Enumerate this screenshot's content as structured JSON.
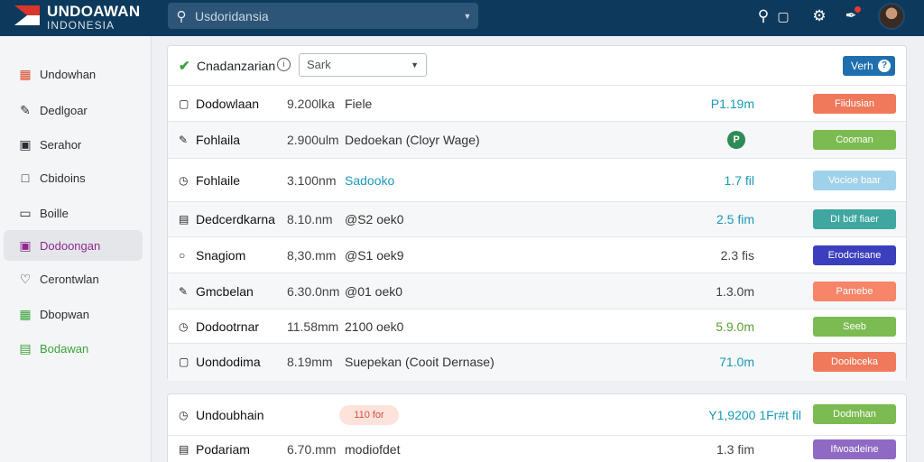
{
  "header": {
    "brand_title": "UNDOAWAN",
    "brand_subtitle": "INDONESIA",
    "search_value": "Usdoridansia"
  },
  "sidebar": {
    "items": [
      {
        "label": "Undowhan",
        "icon": "building-icon"
      },
      {
        "label": "Dedlgoar",
        "icon": "pencil-icon"
      },
      {
        "label": "Serahor",
        "icon": "monitor-icon"
      },
      {
        "label": "Cbidoins",
        "icon": "square-icon"
      },
      {
        "label": "Boille",
        "icon": "clipboard-icon"
      },
      {
        "label": "Dodoongan",
        "icon": "folder-icon"
      },
      {
        "label": "Cerontwlan",
        "icon": "heart-icon"
      },
      {
        "label": "Dbopwan",
        "icon": "calendar-icon"
      },
      {
        "label": "Bodawan",
        "icon": "document-icon"
      }
    ]
  },
  "panel": {
    "title": "Cnadanzarian",
    "select_value": "Sark",
    "header_button": "Verh"
  },
  "rows": [
    {
      "name": "Dodowlaan",
      "size": "9.200lka",
      "desc": "Fiele",
      "value": "P1.19m",
      "action": "Fiidusian"
    },
    {
      "name": "Fohlaila",
      "size": "2.900ulm",
      "desc": "Dedoekan (Cloyr Wage)",
      "value": "",
      "action": "Cooman"
    },
    {
      "name": "Fohlaile",
      "size": "3.100nm",
      "desc": "Sadooko",
      "value": "1.7 fil",
      "action": "Vocioe baar"
    },
    {
      "name": "Dedcerdkarna",
      "size": "8.10.nm",
      "desc": "@S2 oek0",
      "value": "2.5 fim",
      "action": "DI bdf fiaer"
    },
    {
      "name": "Snagiom",
      "size": "8,30.mm",
      "desc": "@S1 oek9",
      "value": "2.3 fis",
      "action": "Erodcrisane"
    },
    {
      "name": "Gmcbelan",
      "size": "6.30.0nm",
      "desc": "@01 oek0",
      "value": "1.3.0m",
      "action": "Pamebe"
    },
    {
      "name": "Dodootrnar",
      "size": "11.58mm",
      "desc": "2100 oek0",
      "value": "5.9.0m",
      "action": "Seeb"
    },
    {
      "name": "Uondodima",
      "size": "8.19mm",
      "desc": "Suepekan (Cooit Dernase)",
      "value": "71.0m",
      "action": "Dooibceka"
    }
  ],
  "rows2": [
    {
      "name": "Undoubhain",
      "pill": "110 for",
      "value": "Y1,9200 1Fr#t fil",
      "action": "Dodmhan"
    },
    {
      "name": "Podariam",
      "size": "6.70.mm",
      "desc": "modiofdet",
      "value": "1.3 fim",
      "action": "Ifwoadeine"
    }
  ],
  "colors": {
    "topbar": "#0d3a5c",
    "accent_purple": "#8e2a8e",
    "value_teal": "#1a9ab8",
    "action_orange": "#f0795c",
    "action_green": "#7cbb52",
    "action_lightblue": "#9fd1ea",
    "action_teal": "#3fa7a0",
    "action_indigo": "#3b3fbd",
    "action_salmon": "#f6856a",
    "action_purple": "#8f6ac4"
  }
}
